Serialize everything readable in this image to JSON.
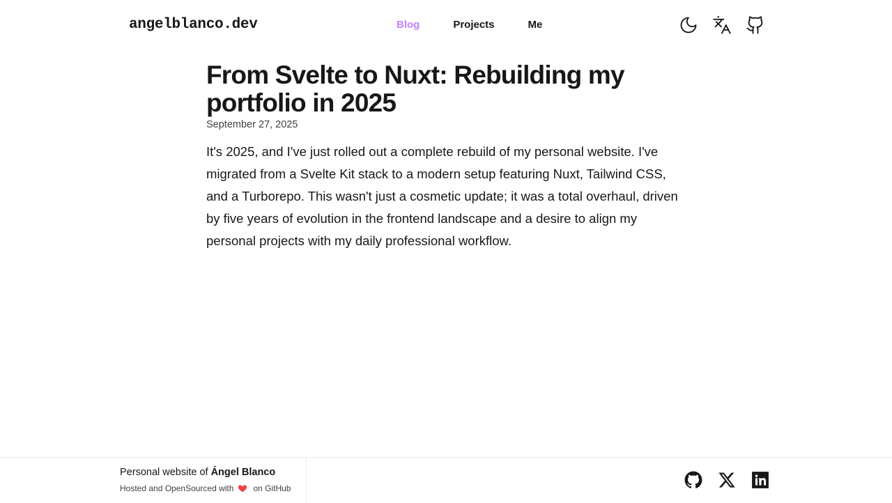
{
  "header": {
    "logo": "angelblanco.dev",
    "nav": [
      {
        "label": "Blog",
        "active": true
      },
      {
        "label": "Projects",
        "active": false
      },
      {
        "label": "Me",
        "active": false
      }
    ],
    "icons": [
      "moon-icon",
      "translate-icon",
      "github-icon"
    ]
  },
  "article": {
    "title": "From Svelte to Nuxt: Rebuilding my portfolio in 2025",
    "date": "September 27, 2025",
    "body": "It's 2025, and I've just rolled out a complete rebuild of my personal website. I've migrated from a Svelte Kit stack to a modern setup featuring Nuxt, Tailwind CSS, and a Turborepo. This wasn't just a cosmetic update; it was a total overhaul, driven by five years of evolution in the frontend landscape and a desire to align my personal projects with my daily professional workflow."
  },
  "footer": {
    "line1_prefix": "Personal website of",
    "owner": "Ángel Blanco",
    "line2_prefix": "Hosted and OpenSourced with",
    "line2_suffix": "on GitHub",
    "social_icons": [
      "github-icon",
      "x-icon",
      "linkedin-icon"
    ]
  },
  "colors": {
    "accent": "#c084fc",
    "text": "#171717",
    "heart": "#ef4444",
    "border": "#ebebeb"
  }
}
